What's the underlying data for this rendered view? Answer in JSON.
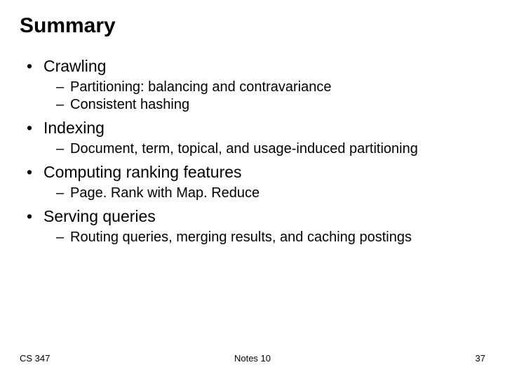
{
  "title": "Summary",
  "bullets": [
    {
      "label": "Crawling",
      "sub": [
        "Partitioning: balancing and contravariance",
        "Consistent hashing"
      ]
    },
    {
      "label": "Indexing",
      "sub": [
        "Document, term, topical, and usage-induced partitioning"
      ]
    },
    {
      "label": "Computing ranking features",
      "sub": [
        "Page. Rank with Map. Reduce"
      ]
    },
    {
      "label": "Serving queries",
      "sub": [
        "Routing queries, merging results, and caching postings"
      ]
    }
  ],
  "footer": {
    "left": "CS 347",
    "center": "Notes 10",
    "right": "37"
  }
}
